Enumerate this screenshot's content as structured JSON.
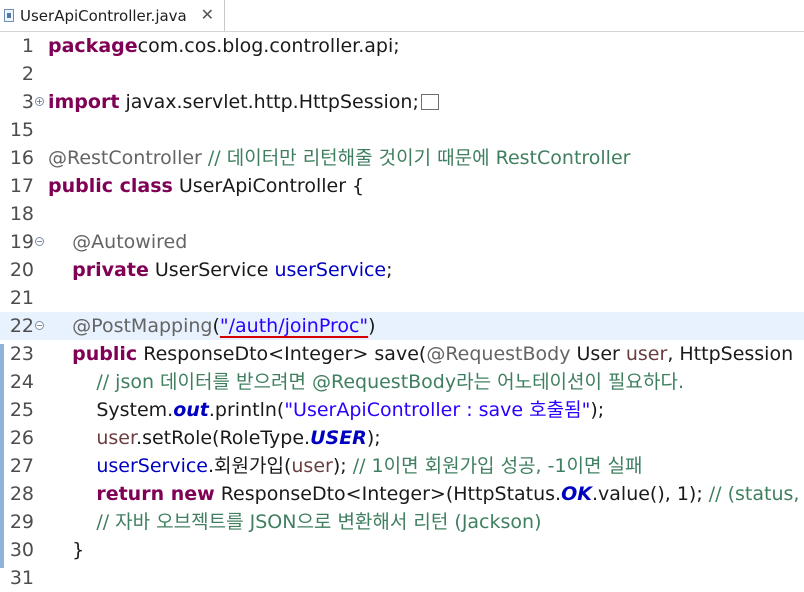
{
  "tab": {
    "title": "UserApiController.java",
    "close": "✕",
    "icon": "java-file-icon"
  },
  "editor": {
    "lines": [
      {
        "num": "1",
        "fold": "",
        "parts": [
          [
            "kw",
            "package"
          ],
          [
            "",
            "com.cos.blog.controller.api;"
          ]
        ]
      },
      {
        "num": "2",
        "fold": "",
        "parts": []
      },
      {
        "num": "3",
        "fold": "+",
        "parts": [
          [
            "kw",
            "import"
          ],
          [
            "",
            " javax.servlet.http.HttpSession;"
          ]
        ]
      },
      {
        "num": "15",
        "fold": "",
        "parts": []
      },
      {
        "num": "16",
        "fold": "",
        "parts": [
          [
            "ann",
            "@RestController"
          ],
          [
            "cm",
            " // 데이터만 리턴해줄 것이기 때문에 RestController"
          ]
        ]
      },
      {
        "num": "17",
        "fold": "",
        "parts": [
          [
            "kw",
            "public class"
          ],
          [
            "",
            " UserApiController {"
          ]
        ]
      },
      {
        "num": "18",
        "fold": "",
        "parts": []
      },
      {
        "num": "19",
        "fold": "−",
        "parts": [
          [
            "",
            "    "
          ],
          [
            "ann",
            "@Autowired"
          ]
        ]
      },
      {
        "num": "20",
        "fold": "",
        "parts": [
          [
            "",
            "    "
          ],
          [
            "kw",
            "private"
          ],
          [
            "",
            " UserService "
          ],
          [
            "fld",
            "userService"
          ],
          [
            "",
            ";"
          ]
        ]
      },
      {
        "num": "21",
        "fold": "",
        "parts": []
      },
      {
        "num": "22",
        "fold": "−",
        "parts": [
          [
            "",
            "    "
          ],
          [
            "ann",
            "@PostMapping"
          ],
          [
            "",
            "("
          ],
          [
            "str",
            "\"/auth/joinProc\""
          ],
          [
            "",
            ")"
          ]
        ]
      },
      {
        "num": "23",
        "fold": "",
        "parts": [
          [
            "",
            "    "
          ],
          [
            "kw",
            "public"
          ],
          [
            "",
            " ResponseDto<Integer> save("
          ],
          [
            "ann",
            "@RequestBody"
          ],
          [
            "",
            " User "
          ],
          [
            "lvar",
            "user"
          ],
          [
            "",
            ", HttpSession"
          ]
        ]
      },
      {
        "num": "24",
        "fold": "",
        "parts": [
          [
            "",
            "        "
          ],
          [
            "cm",
            "// json 데이터를 받으려면 @RequestBody라는 어노테이션이 필요하다."
          ]
        ]
      },
      {
        "num": "25",
        "fold": "",
        "parts": [
          [
            "",
            "        System."
          ],
          [
            "stat",
            "out"
          ],
          [
            "",
            ".println("
          ],
          [
            "str",
            "\"UserApiController : save 호출됨\""
          ],
          [
            "",
            ");"
          ]
        ]
      },
      {
        "num": "26",
        "fold": "",
        "parts": [
          [
            "",
            "        "
          ],
          [
            "lvar",
            "user"
          ],
          [
            "",
            ".setRole(RoleType."
          ],
          [
            "stat",
            "USER"
          ],
          [
            "",
            ");"
          ]
        ]
      },
      {
        "num": "27",
        "fold": "",
        "parts": [
          [
            "",
            "        "
          ],
          [
            "fld",
            "userService"
          ],
          [
            "",
            ".회원가입("
          ],
          [
            "lvar",
            "user"
          ],
          [
            "",
            "); "
          ],
          [
            "cm",
            "// 1이면 회원가입 성공, -1이면 실패"
          ]
        ]
      },
      {
        "num": "28",
        "fold": "",
        "parts": [
          [
            "",
            "        "
          ],
          [
            "kw",
            "return new"
          ],
          [
            "",
            " ResponseDto<Integer>(HttpStatus."
          ],
          [
            "stat",
            "OK"
          ],
          [
            "",
            ".value(), 1); "
          ],
          [
            "cm",
            "// (status,"
          ]
        ]
      },
      {
        "num": "29",
        "fold": "",
        "parts": [
          [
            "",
            "        "
          ],
          [
            "cm",
            "// 자바 오브젝트를 JSON으로 변환해서 리턴 (Jackson)"
          ]
        ]
      },
      {
        "num": "30",
        "fold": "",
        "parts": [
          [
            "",
            "    }"
          ]
        ]
      },
      {
        "num": "31",
        "fold": "",
        "parts": []
      }
    ]
  }
}
